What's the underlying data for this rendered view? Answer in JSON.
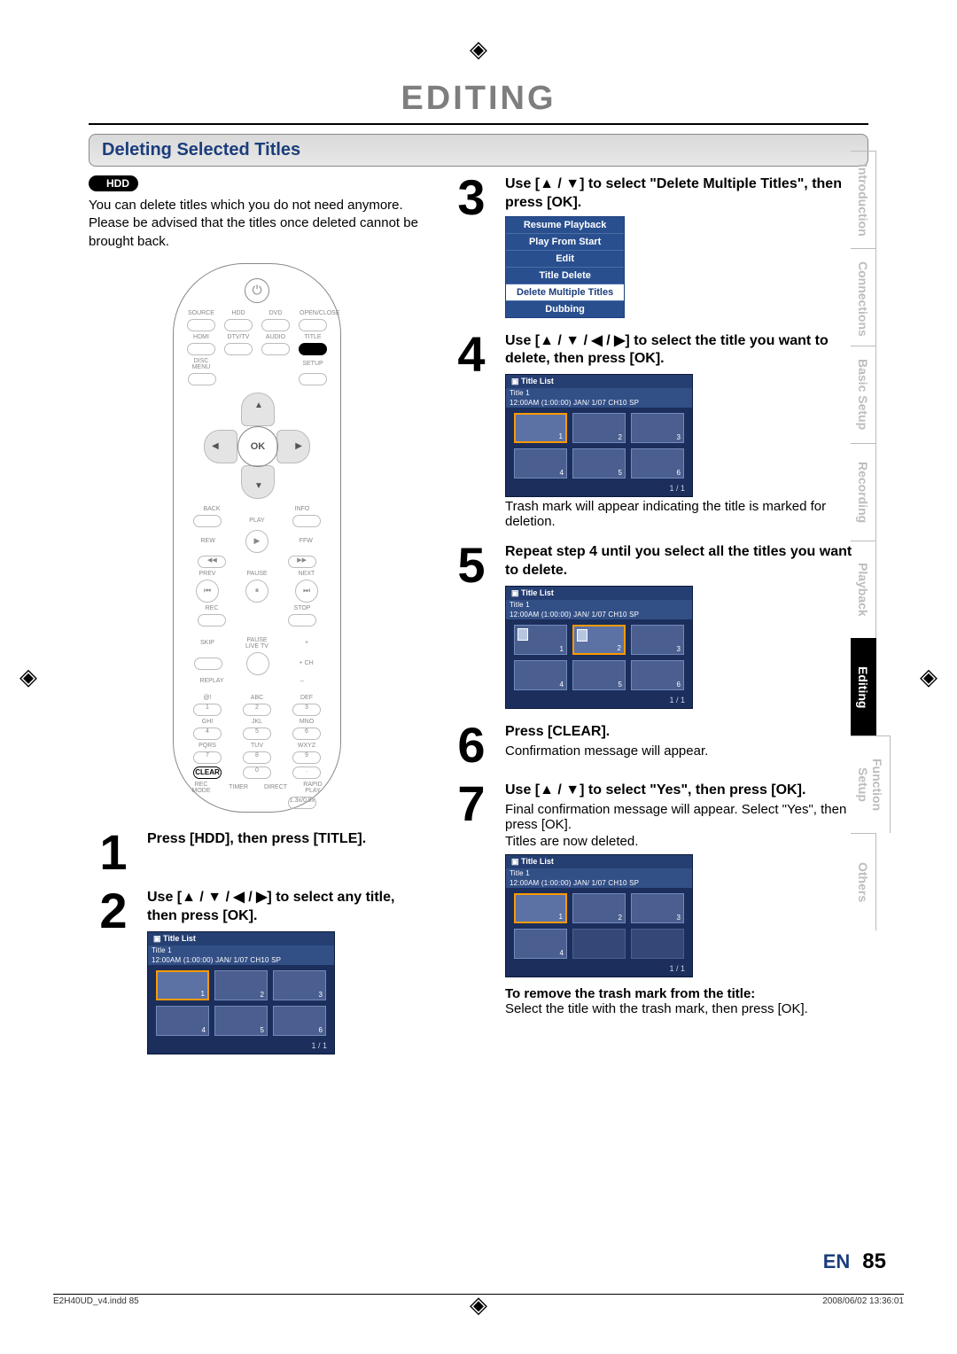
{
  "chapter": "EDITING",
  "section_title": "Deleting Selected Titles",
  "badge": "HDD",
  "intro": "You can delete titles which you do not need anymore. Please be advised that the titles once deleted cannot be brought back.",
  "remote": {
    "row1": [
      "SOURCE",
      "HDD",
      "DVD",
      "OPEN/CLOSE"
    ],
    "row2": [
      "HDMI",
      "DTV/TV",
      "AUDIO",
      "TITLE"
    ],
    "row3_left": "DISC MENU",
    "row3_right": "SETUP",
    "ok": "OK",
    "back": "BACK",
    "info": "INFO",
    "play": "PLAY",
    "rew": "REW",
    "ffw": "FFW",
    "prev": "PREV",
    "pause": "PAUSE",
    "next": "NEXT",
    "rec": "REC",
    "stop": "STOP",
    "skip": "SKIP",
    "pauselive": "PAUSE LIVE TV",
    "replay": "REPLAY",
    "chup": "+ CH",
    "chdn": "– CH –",
    "numlabels": [
      "@!",
      "ABC",
      "DEF",
      "GHI",
      "JKL",
      "MNO",
      "PQRS",
      "TUV",
      "WXYZ"
    ],
    "nums": [
      "1",
      "2",
      "3",
      "4",
      "5",
      "6",
      "7",
      "8",
      "9",
      "0"
    ],
    "clear": "CLEAR",
    "dot": ".",
    "bottom": [
      "REC MODE",
      "TIMER",
      "DIRECT",
      "RAPID PLAY"
    ],
    "speed": "1.3x/0.8x"
  },
  "steps_left": [
    {
      "n": "1",
      "head": "Press [HDD], then press [TITLE]."
    },
    {
      "n": "2",
      "head_parts": [
        "Use [",
        "▲ / ▼ / ◀ / ▶",
        "] to select any title, then press [OK]."
      ]
    }
  ],
  "steps_right": [
    {
      "n": "3",
      "head_parts": [
        "Use [",
        "▲ / ▼",
        "] to select \"Delete Multiple Titles\", then press [OK]."
      ],
      "menu": [
        "Resume Playback",
        "Play From Start",
        "Edit",
        "Title Delete",
        "Delete Multiple Titles",
        "Dubbing"
      ],
      "menu_sel": 4
    },
    {
      "n": "4",
      "head_parts": [
        "Use [",
        "▲ / ▼ / ◀ / ▶",
        "] to select the title you want to delete, then press [OK]."
      ],
      "tail": "Trash mark will appear indicating the title is marked for deletion."
    },
    {
      "n": "5",
      "head": "Repeat step 4 until you select all the titles you want to delete."
    },
    {
      "n": "6",
      "head": "Press [CLEAR].",
      "tail": "Confirmation message will appear."
    },
    {
      "n": "7",
      "head_parts": [
        "Use [",
        "▲ / ▼",
        "] to select \"Yes\", then press [OK]."
      ],
      "tail": "Final confirmation message will appear. Select \"Yes\", then press [OK].",
      "tail2": "Titles are now deleted."
    }
  ],
  "title_list": {
    "header": "Title List",
    "title": "Title 1",
    "info": "12:00AM (1:00:00)    JAN/  1/07        CH10   SP",
    "pager": "1 / 1"
  },
  "title_lists": {
    "step2": {
      "sel": [
        1
      ],
      "present": [
        1,
        2,
        3,
        4,
        5,
        6
      ],
      "trash": []
    },
    "step4": {
      "sel": [
        1
      ],
      "present": [
        1,
        2,
        3,
        4,
        5,
        6
      ],
      "trash": []
    },
    "step5": {
      "sel": [
        2
      ],
      "present": [
        1,
        2,
        3,
        4,
        5,
        6
      ],
      "trash": [
        1,
        2
      ]
    },
    "step7": {
      "sel": [
        1
      ],
      "present": [
        1,
        2,
        3,
        4
      ],
      "trash": []
    }
  },
  "remove_head": "To remove the trash mark from the title:",
  "remove_text": "Select the title with the trash mark, then press [OK].",
  "sidetabs": [
    "Introduction",
    "Connections",
    "Basic Setup",
    "Recording",
    "Playback",
    "Editing",
    "Function Setup",
    "Others"
  ],
  "sidetab_active": 5,
  "page_lang": "EN",
  "page_number": "85",
  "footer_left": "E2H40UD_v4.indd   85",
  "footer_right": "2008/06/02   13:36:01"
}
